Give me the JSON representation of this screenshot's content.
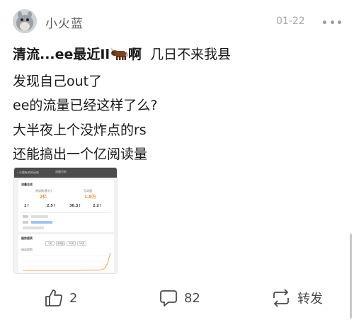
{
  "post": {
    "username": "小火蓝",
    "date": "01-22",
    "title_bold": "清流...ee最近Il",
    "title_bold_tail": "啊",
    "title_rest": "  几日不来我县",
    "lines": [
      "发现自己out了",
      "ee的流量已经这样了么?",
      "大半夜上个没炸点的rs",
      "还能搞出一个亿阅读量"
    ]
  },
  "thumbnail": {
    "header_title": "流量分析",
    "back_label": "‹ 与我有关的动态",
    "section1_title": "流量总览",
    "metric_left_label": "阅读数(累计)",
    "metric_left_value": "2亿",
    "metric_right_label": "互动量",
    "metric_right_value": "1.8万",
    "stats": [
      "1↑",
      "2.5↑",
      "30.3↑",
      "2.2↑"
    ],
    "section2_title": "趋势图表",
    "tabs": [
      "7天",
      "15天",
      "30天",
      "90天"
    ],
    "chart_label": "阅读趋势"
  },
  "actions": {
    "likes": "2",
    "comments": "82",
    "repost_label": "转发"
  },
  "icons": {
    "like": "thumbs-up-icon",
    "comment": "comment-bubble-icon",
    "repost": "repost-arrows-icon",
    "more": "more-dots-icon",
    "ox": "ox-emoji-icon"
  }
}
